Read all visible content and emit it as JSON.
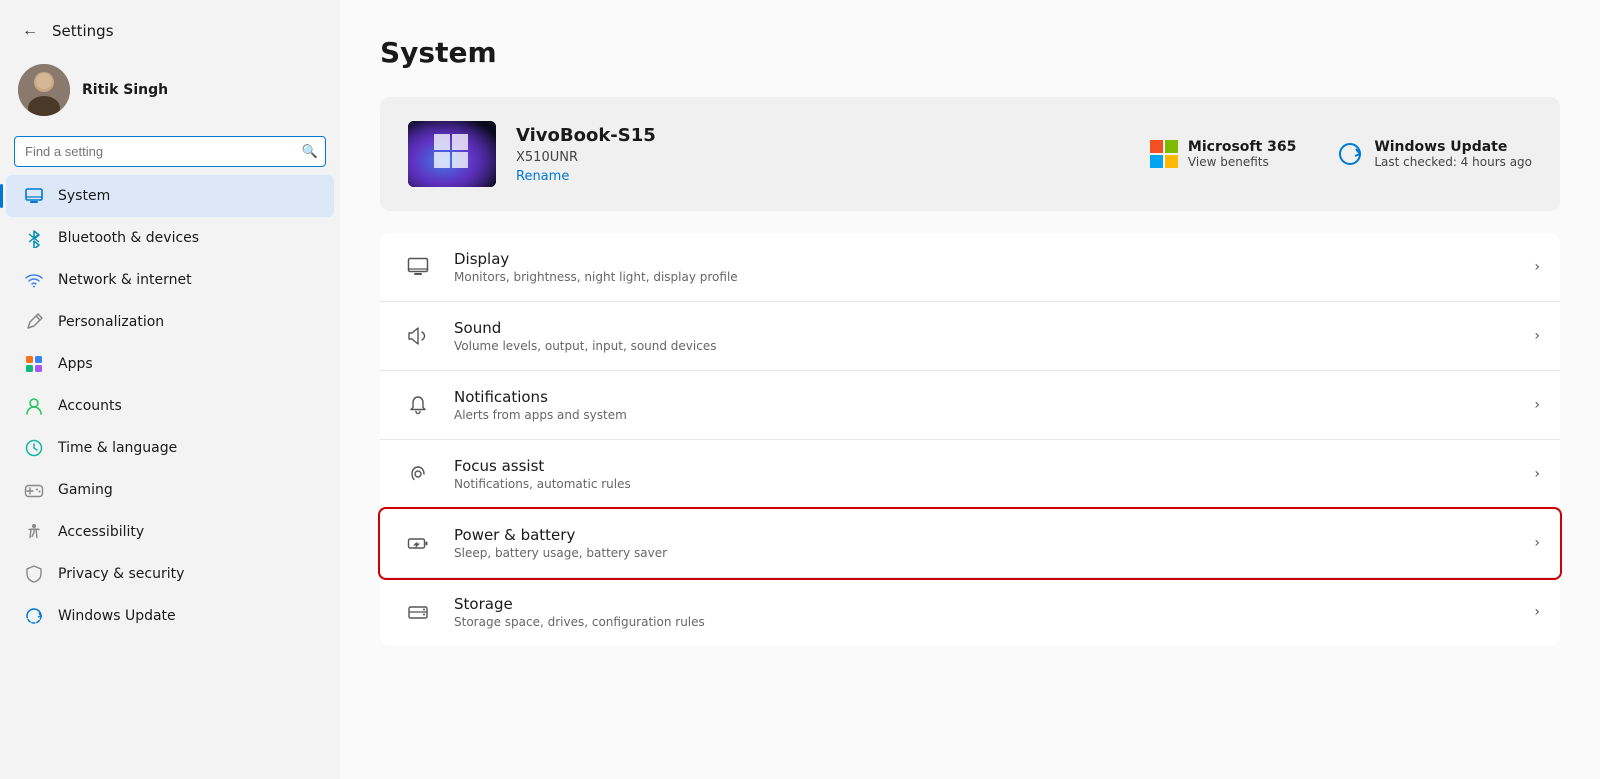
{
  "window": {
    "title": "Settings"
  },
  "sidebar": {
    "back_label": "←",
    "title": "Settings",
    "user": {
      "name": "Ritik Singh"
    },
    "search": {
      "placeholder": "Find a setting"
    },
    "nav": [
      {
        "id": "system",
        "label": "System",
        "icon": "🖥",
        "active": true
      },
      {
        "id": "bluetooth",
        "label": "Bluetooth & devices",
        "icon": "🔷",
        "active": false
      },
      {
        "id": "network",
        "label": "Network & internet",
        "icon": "🌐",
        "active": false
      },
      {
        "id": "personalization",
        "label": "Personalization",
        "icon": "✏️",
        "active": false
      },
      {
        "id": "apps",
        "label": "Apps",
        "icon": "📦",
        "active": false
      },
      {
        "id": "accounts",
        "label": "Accounts",
        "icon": "👤",
        "active": false
      },
      {
        "id": "time",
        "label": "Time & language",
        "icon": "🌍",
        "active": false
      },
      {
        "id": "gaming",
        "label": "Gaming",
        "icon": "🎮",
        "active": false
      },
      {
        "id": "accessibility",
        "label": "Accessibility",
        "icon": "♿",
        "active": false
      },
      {
        "id": "privacy",
        "label": "Privacy & security",
        "icon": "🛡",
        "active": false
      },
      {
        "id": "windows-update",
        "label": "Windows Update",
        "icon": "🔄",
        "active": false
      }
    ]
  },
  "main": {
    "page_title": "System",
    "device": {
      "name": "VivoBook-S15",
      "model": "X510UNR",
      "rename_label": "Rename"
    },
    "actions": [
      {
        "id": "ms365",
        "title": "Microsoft 365",
        "subtitle": "View benefits"
      },
      {
        "id": "windows-update",
        "title": "Windows Update",
        "subtitle": "Last checked: 4 hours ago"
      }
    ],
    "settings": [
      {
        "id": "display",
        "name": "Display",
        "desc": "Monitors, brightness, night light, display profile",
        "highlighted": false
      },
      {
        "id": "sound",
        "name": "Sound",
        "desc": "Volume levels, output, input, sound devices",
        "highlighted": false
      },
      {
        "id": "notifications",
        "name": "Notifications",
        "desc": "Alerts from apps and system",
        "highlighted": false
      },
      {
        "id": "focus-assist",
        "name": "Focus assist",
        "desc": "Notifications, automatic rules",
        "highlighted": false
      },
      {
        "id": "power-battery",
        "name": "Power & battery",
        "desc": "Sleep, battery usage, battery saver",
        "highlighted": true
      },
      {
        "id": "storage",
        "name": "Storage",
        "desc": "Storage space, drives, configuration rules",
        "highlighted": false
      }
    ]
  }
}
